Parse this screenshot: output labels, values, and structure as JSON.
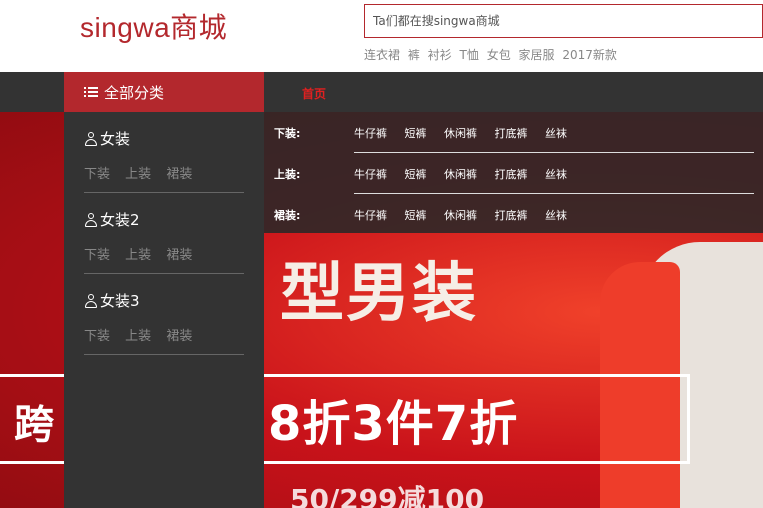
{
  "header": {
    "logo": "singwa商城",
    "search_placeholder": "Ta们都在搜singwa商城",
    "hot_links": [
      "连衣裙",
      "裤",
      "衬衫",
      "T恤",
      "女包",
      "家居服",
      "2017新款"
    ]
  },
  "nav": {
    "all_categories": "全部分类",
    "home": "首页"
  },
  "categories": [
    {
      "title": "女装",
      "subs": [
        "下装",
        "上装",
        "裙装"
      ]
    },
    {
      "title": "女装2",
      "subs": [
        "下装",
        "上装",
        "裙装"
      ]
    },
    {
      "title": "女装3",
      "subs": [
        "下装",
        "上装",
        "裙装"
      ]
    }
  ],
  "submenu": [
    {
      "label": "下装:",
      "items": [
        "牛仔裤",
        "短裤",
        "休闲裤",
        "打底裤",
        "丝袜"
      ]
    },
    {
      "label": "上装:",
      "items": [
        "牛仔裤",
        "短裤",
        "休闲裤",
        "打底裤",
        "丝袜"
      ]
    },
    {
      "label": "裙装:",
      "items": [
        "牛仔裤",
        "短裤",
        "休闲裤",
        "打底裤",
        "丝袜"
      ]
    }
  ],
  "banner": {
    "line1": "型男装",
    "line2": "8折3件7折",
    "line3": "跨",
    "line4": "50/299减100",
    "colors": {
      "main": "#d8141c",
      "accent": "#b3282d"
    }
  }
}
